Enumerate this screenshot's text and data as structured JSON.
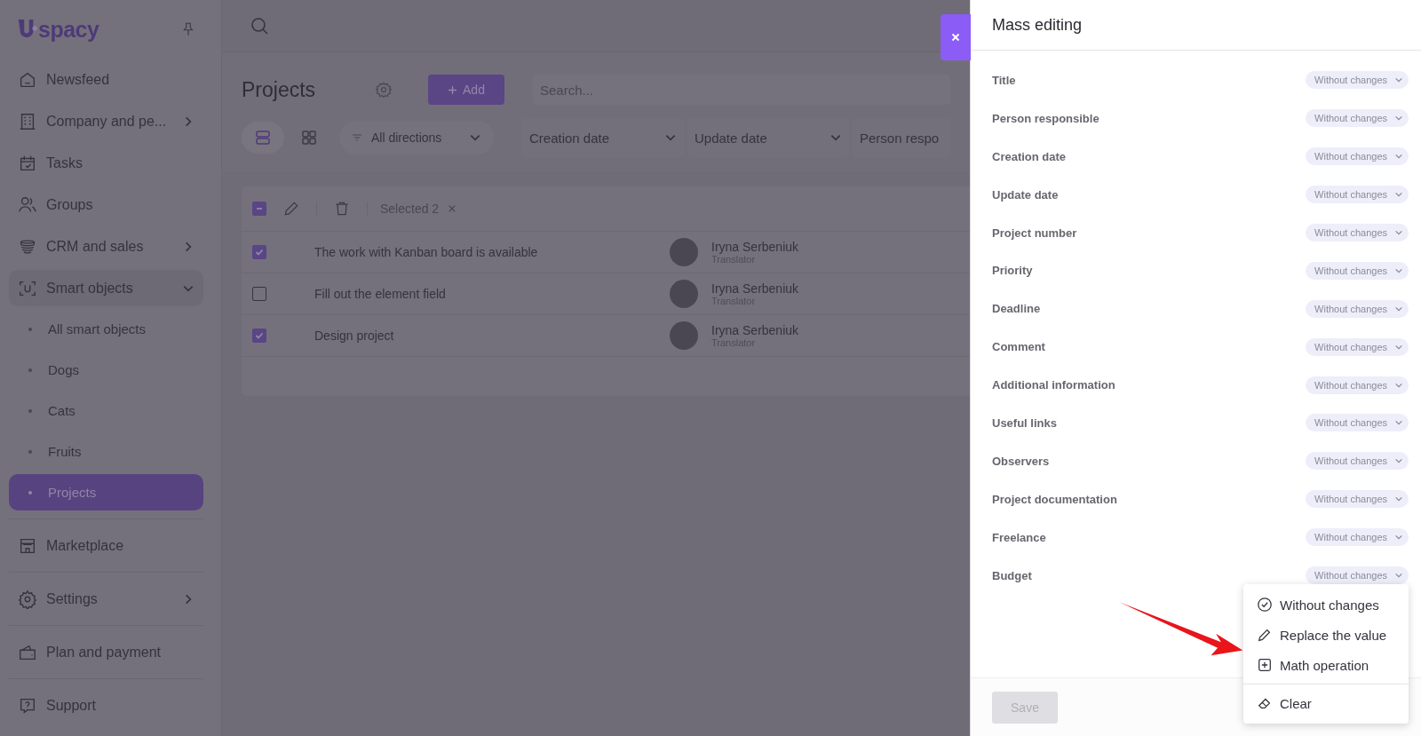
{
  "sidebar": {
    "logo": "spacy",
    "items": [
      {
        "label": "Newsfeed",
        "expandable": false
      },
      {
        "label": "Company and pe...",
        "expandable": true,
        "expanded": false
      },
      {
        "label": "Tasks",
        "expandable": false
      },
      {
        "label": "Groups",
        "expandable": false
      },
      {
        "label": "CRM and sales",
        "expandable": true,
        "expanded": false
      },
      {
        "label": "Smart objects",
        "expandable": true,
        "expanded": true,
        "children": [
          {
            "label": "All smart objects",
            "selected": false
          },
          {
            "label": "Dogs",
            "selected": false
          },
          {
            "label": "Cats",
            "selected": false
          },
          {
            "label": "Fruits",
            "selected": false
          },
          {
            "label": "Projects",
            "selected": true
          }
        ]
      }
    ],
    "bottom_items": [
      {
        "label": "Marketplace",
        "expandable": false
      },
      {
        "label": "Settings",
        "expandable": true,
        "expanded": false
      },
      {
        "label": "Plan and payment",
        "expandable": false
      },
      {
        "label": "Support",
        "expandable": false
      }
    ]
  },
  "page": {
    "title": "Projects",
    "add_button": "Add",
    "search": {
      "placeholder": "Search..."
    },
    "views": [
      {
        "kind": "list",
        "selected": true
      },
      {
        "kind": "grid",
        "selected": false
      }
    ],
    "filters": [
      "All directions",
      "Creation date",
      "Update date",
      "Person respo"
    ]
  },
  "table": {
    "header_checked": true,
    "header_indeterminate": true,
    "selected_count": "Selected 2",
    "rows": [
      {
        "checked": true,
        "title": "The work with Kanban board is available",
        "person": "Iryna Serbeniuk",
        "role": "Translator"
      },
      {
        "checked": false,
        "title": "Fill out the element field",
        "person": "Iryna Serbeniuk",
        "role": "Translator"
      },
      {
        "checked": true,
        "title": "Design project",
        "person": "Iryna Serbeniuk",
        "role": "Translator"
      }
    ]
  },
  "panel": {
    "title": "Mass editing",
    "fields": [
      {
        "label": "Title",
        "value": "Without changes"
      },
      {
        "label": "Person responsible",
        "value": "Without changes"
      },
      {
        "label": "Creation date",
        "value": "Without changes"
      },
      {
        "label": "Update date",
        "value": "Without changes"
      },
      {
        "label": "Project number",
        "value": "Without changes"
      },
      {
        "label": "Priority",
        "value": "Without changes"
      },
      {
        "label": "Deadline",
        "value": "Without changes"
      },
      {
        "label": "Comment",
        "value": "Without changes"
      },
      {
        "label": "Additional information",
        "value": "Without changes"
      },
      {
        "label": "Useful links",
        "value": "Without changes"
      },
      {
        "label": "Observers",
        "value": "Without changes"
      },
      {
        "label": "Project documentation",
        "value": "Without changes"
      },
      {
        "label": "Freelance",
        "value": "Without changes"
      },
      {
        "label": "Budget",
        "value": "Without changes"
      }
    ],
    "save_button": {
      "label": "Save",
      "disabled": true
    },
    "menu": [
      {
        "kind": "check",
        "label": "Without changes"
      },
      {
        "kind": "pencil",
        "label": "Replace the value"
      },
      {
        "kind": "plus",
        "label": "Math operation"
      },
      {
        "kind": "eraser",
        "label": "Clear"
      }
    ]
  }
}
